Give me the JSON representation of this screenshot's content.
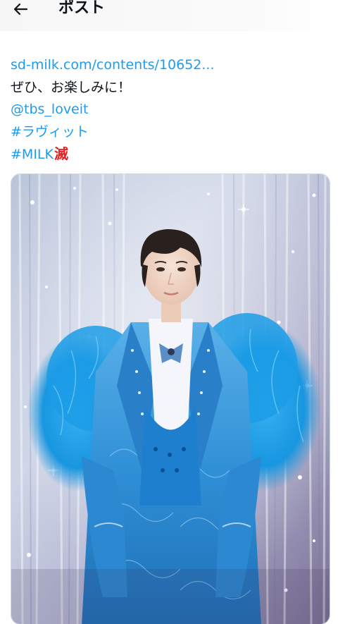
{
  "header": {
    "back_icon": "arrow-left-icon",
    "title": "ポスト"
  },
  "tweet": {
    "link_text": "sd-milk.com/contents/10652...",
    "body_text": "ぜひ、お楽しみに！",
    "mention": "@tbs_loveit",
    "hashtag_1": "#ラヴィット",
    "hashtag_2": "#MILK",
    "hashtag_2_emoji": "滅"
  },
  "media": {
    "image_subject": "photo"
  },
  "colors": {
    "link": "#1d9bf0",
    "text": "#0f1419",
    "emoji": "#e8201f",
    "outfit_blue": "#2a8fd8",
    "feather_blue": "#1a9fe6"
  }
}
